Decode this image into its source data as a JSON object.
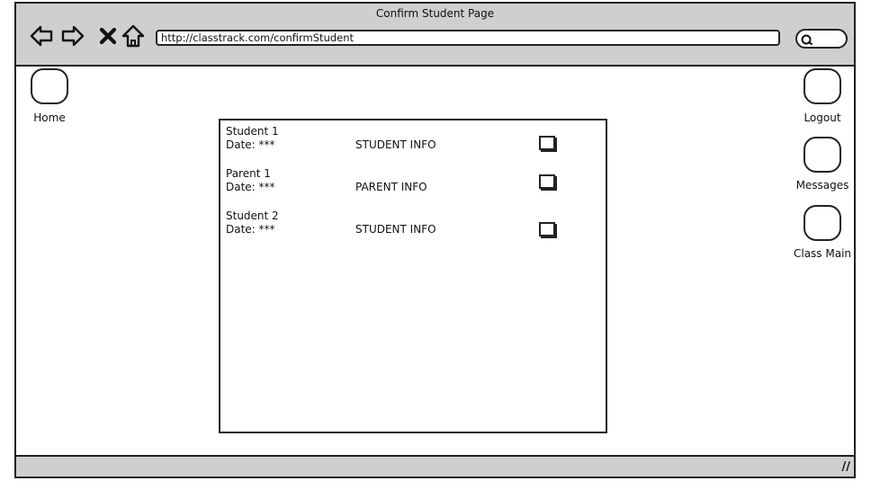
{
  "window": {
    "title": "Confirm Student Page"
  },
  "toolbar": {
    "url": "http://classtrack.com/confirmStudent",
    "buttons": [
      "back-icon",
      "forward-icon",
      "close-icon",
      "home-icon"
    ]
  },
  "side_nav": {
    "left": [
      {
        "label": "Home",
        "icon": "home-button-icon"
      }
    ],
    "right": [
      {
        "label": "Logout",
        "icon": "logout-icon"
      },
      {
        "label": "Messages",
        "icon": "messages-icon"
      },
      {
        "label": "Class Main",
        "icon": "class-main-icon"
      }
    ]
  },
  "confirm_list": {
    "rows": [
      {
        "name": "Student 1",
        "date": "Date: ***",
        "info": "STUDENT INFO",
        "checked": false
      },
      {
        "name": "Parent 1",
        "date": "Date: ***",
        "info": "PARENT INFO",
        "checked": false
      },
      {
        "name": "Student 2",
        "date": "Date: ***",
        "info": "STUDENT INFO",
        "checked": false
      }
    ]
  }
}
